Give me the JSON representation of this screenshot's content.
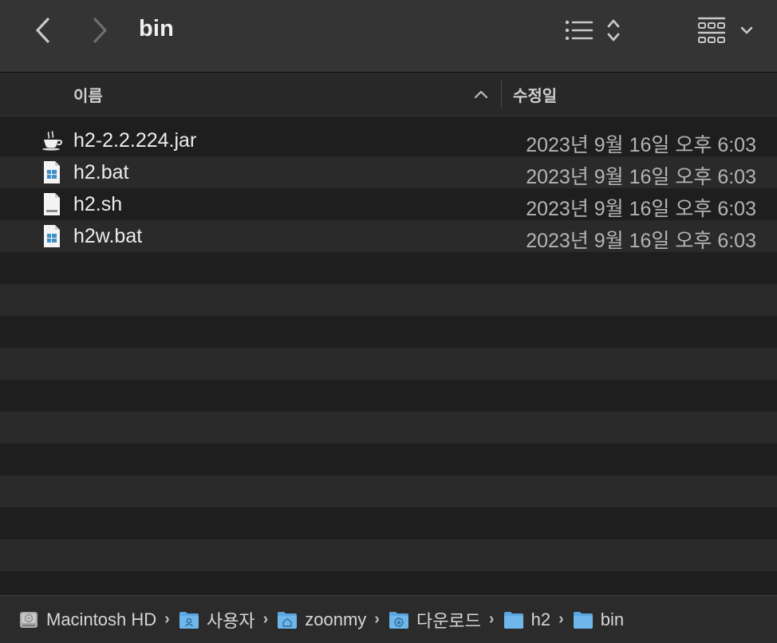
{
  "window": {
    "title": "bin"
  },
  "toolbar": {
    "back_icon": "chevron-left-icon",
    "forward_icon": "chevron-right-icon",
    "view_list_icon": "list-view-icon",
    "view_group_icon": "grid-view-icon"
  },
  "columns": {
    "name": "이름",
    "modified": "수정일",
    "sort_direction": "ascending"
  },
  "files": [
    {
      "name": "h2-2.2.224.jar",
      "modified": "2023년 9월 16일 오후 6:03",
      "icon": "java-cup-icon"
    },
    {
      "name": "h2.bat",
      "modified": "2023년 9월 16일 오후 6:03",
      "icon": "windows-document-icon"
    },
    {
      "name": "h2.sh",
      "modified": "2023년 9월 16일 오후 6:03",
      "icon": "shell-script-icon"
    },
    {
      "name": "h2w.bat",
      "modified": "2023년 9월 16일 오후 6:03",
      "icon": "windows-document-icon"
    }
  ],
  "path": [
    {
      "label": "Macintosh HD",
      "icon": "hard-drive-icon"
    },
    {
      "label": "사용자",
      "icon": "users-folder-icon"
    },
    {
      "label": "zoonmy",
      "icon": "home-folder-icon"
    },
    {
      "label": "다운로드",
      "icon": "downloads-folder-icon"
    },
    {
      "label": "h2",
      "icon": "folder-icon"
    },
    {
      "label": "bin",
      "icon": "folder-icon"
    }
  ],
  "colors": {
    "folder_blue": "#5aa6e0",
    "window_bg": "#1e1e1e",
    "toolbar_bg": "#343434",
    "row_alt": "#2a2a2a"
  }
}
